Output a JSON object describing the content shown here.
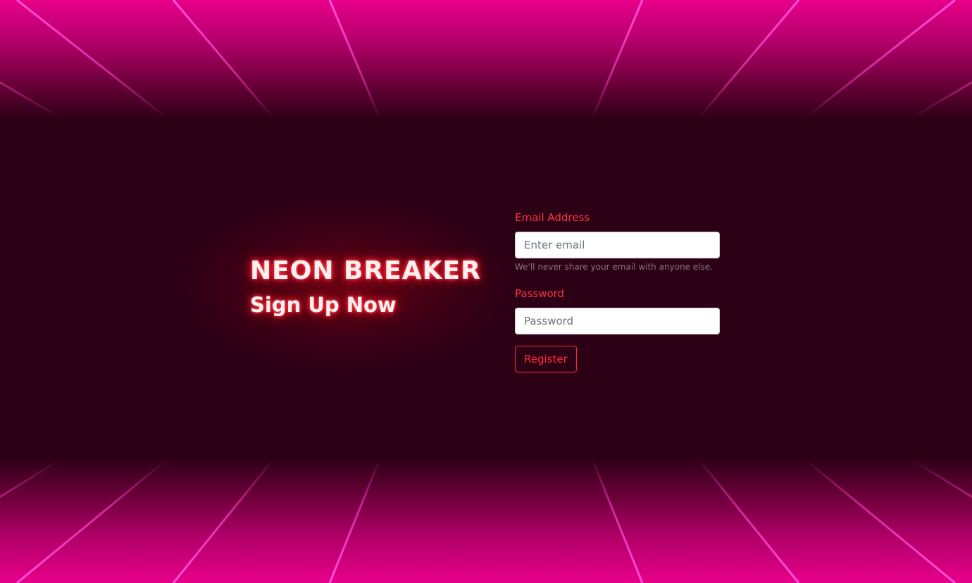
{
  "hero": {
    "title": "NEON BREAKER",
    "subtitle": "Sign Up Now"
  },
  "form": {
    "email_label": "Email Address",
    "email_placeholder": "Enter email",
    "email_help": "We'll never share your email with anyone else.",
    "password_label": "Password",
    "password_placeholder": "Password",
    "submit_label": "Register"
  },
  "colors": {
    "background": "#2c0015",
    "grid_fill": "#e6007e",
    "grid_line": "#ff3fd0",
    "accent": "#ff2a3c",
    "glow_text": "#fff1f1"
  }
}
